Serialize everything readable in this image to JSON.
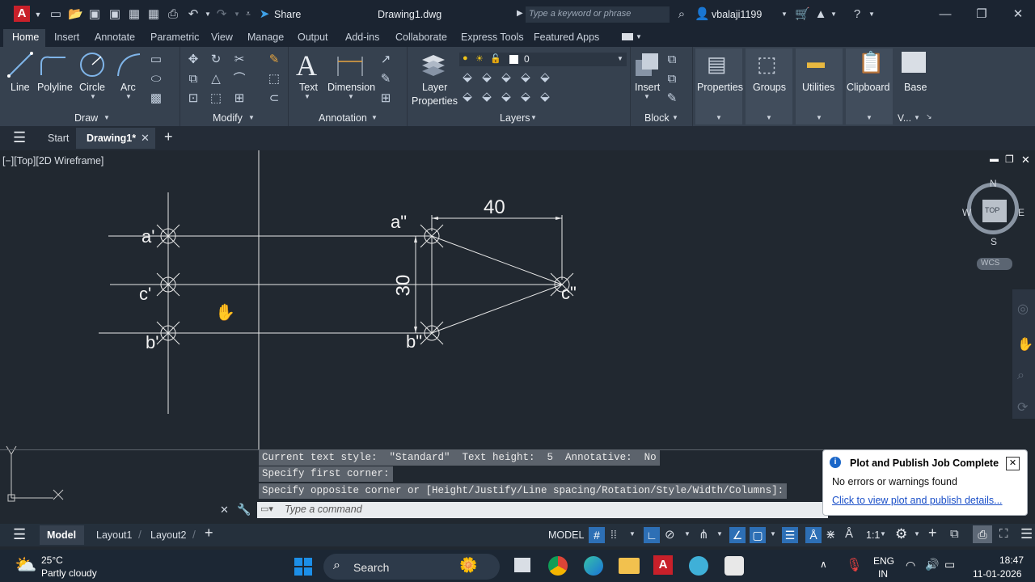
{
  "titlebar": {
    "app_icon": "A",
    "share": "Share",
    "doc_title": "Drawing1.dwg",
    "search_placeholder": "Type a keyword or phrase",
    "user": "vbalaji1199"
  },
  "ribbon_tabs": [
    "Home",
    "Insert",
    "Annotate",
    "Parametric",
    "View",
    "Manage",
    "Output",
    "Add-ins",
    "Collaborate",
    "Express Tools",
    "Featured Apps"
  ],
  "ribbon": {
    "draw": {
      "line": "Line",
      "polyline": "Polyline",
      "circle": "Circle",
      "arc": "Arc",
      "label": "Draw"
    },
    "modify": {
      "label": "Modify"
    },
    "annotation": {
      "text": "Text",
      "dimension": "Dimension",
      "label": "Annotation"
    },
    "layers": {
      "layer_properties_1": "Layer",
      "layer_properties_2": "Properties",
      "current_layer": "0",
      "label": "Layers"
    },
    "block": {
      "insert": "Insert",
      "label": "Block"
    },
    "properties": "Properties",
    "groups": "Groups",
    "utilities": "Utilities",
    "clipboard": "Clipboard",
    "base": "Base",
    "view_short": "V..."
  },
  "file_tabs": {
    "start": "Start",
    "drawing": "Drawing1*"
  },
  "viewport_label": "[−][Top][2D Wireframe]",
  "viewcube": {
    "n": "N",
    "s": "S",
    "e": "E",
    "w": "W",
    "top": "TOP",
    "wcs": "WCS"
  },
  "drawing": {
    "labels": {
      "a1": "a'",
      "c1": "c'",
      "b1": "b'",
      "a2": "a\"",
      "b2": "b\"",
      "c2": "c\""
    },
    "dim_horizontal": "40",
    "dim_vertical": "30"
  },
  "command_history": [
    "Current text style:  \"Standard\"  Text height:  5  Annotative:  No",
    "Specify first corner:",
    "Specify opposite corner or [Height/Justify/Line spacing/Rotation/Style/Width/Columns]:"
  ],
  "command_placeholder": "Type a command",
  "notification": {
    "title": "Plot and Publish Job Complete",
    "message": "No errors or warnings found",
    "link": "Click to view plot and publish details..."
  },
  "layout_tabs": {
    "model": "Model",
    "layout1": "Layout1",
    "layout2": "Layout2"
  },
  "status": {
    "model": "MODEL",
    "scale": "1:1"
  },
  "taskbar": {
    "temp": "25°C",
    "weather": "Partly cloudy",
    "search": "Search",
    "lang1": "ENG",
    "lang2": "IN",
    "time": "18:47",
    "date": "11-01-2026"
  }
}
